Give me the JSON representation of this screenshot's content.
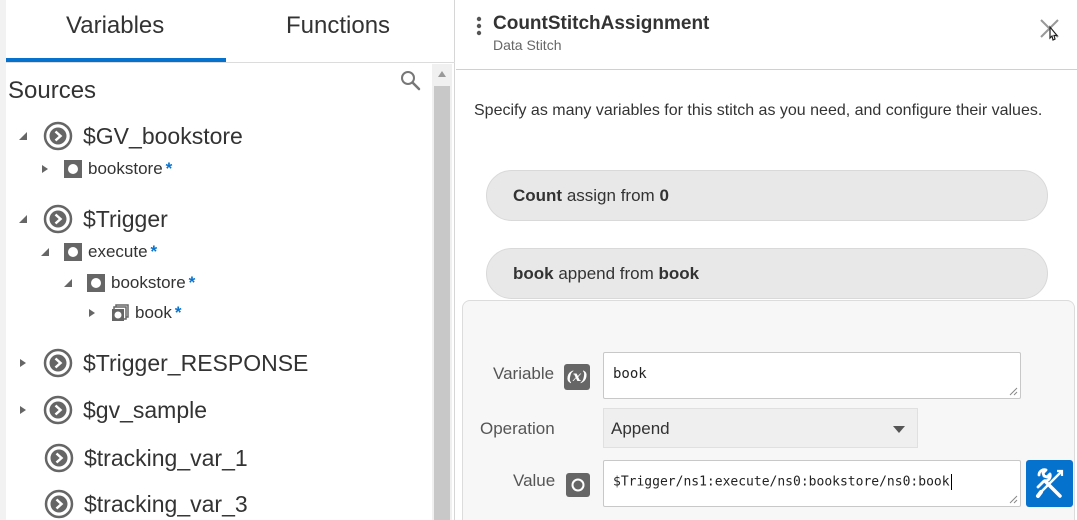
{
  "tabs": {
    "variables": "Variables",
    "functions": "Functions"
  },
  "sources": {
    "title": "Sources",
    "tree": {
      "gv_bookstore": "$GV_bookstore",
      "bookstore": "bookstore",
      "trigger": "$Trigger",
      "execute": "execute",
      "trigger_bookstore": "bookstore",
      "book": "book",
      "trigger_response": "$Trigger_RESPONSE",
      "gv_sample": "$gv_sample",
      "tracking_var_1": "$tracking_var_1",
      "tracking_var_3": "$tracking_var_3"
    },
    "required_marker": "*"
  },
  "panel": {
    "title": "CountStitchAssignment",
    "subtitle": "Data Stitch",
    "description": "Specify as many variables for this stitch as you need, and configure their values."
  },
  "assignments": [
    {
      "variable": "Count",
      "operation_text": "assign from",
      "source": "0"
    },
    {
      "variable": "book",
      "operation_text": "append from",
      "source": "book"
    }
  ],
  "editor": {
    "variable_label": "Variable",
    "variable_icon_text": "(x)",
    "variable_value": "book",
    "operation_label": "Operation",
    "operation_value": "Append",
    "value_label": "Value",
    "value_text": "$Trigger/ns1:execute/ns0:bookstore/ns0:book"
  },
  "colors": {
    "accent": "#0572ce",
    "pill_bg": "#e8e8e8",
    "icon_gray": "#666666"
  },
  "icons": {
    "search": "search-icon",
    "close": "close-icon",
    "namespace": "namespace-circle-arrow-icon",
    "element": "element-square-icon",
    "repeating_element": "repeating-element-icon",
    "mapper": "wrench-screwdriver-icon"
  }
}
